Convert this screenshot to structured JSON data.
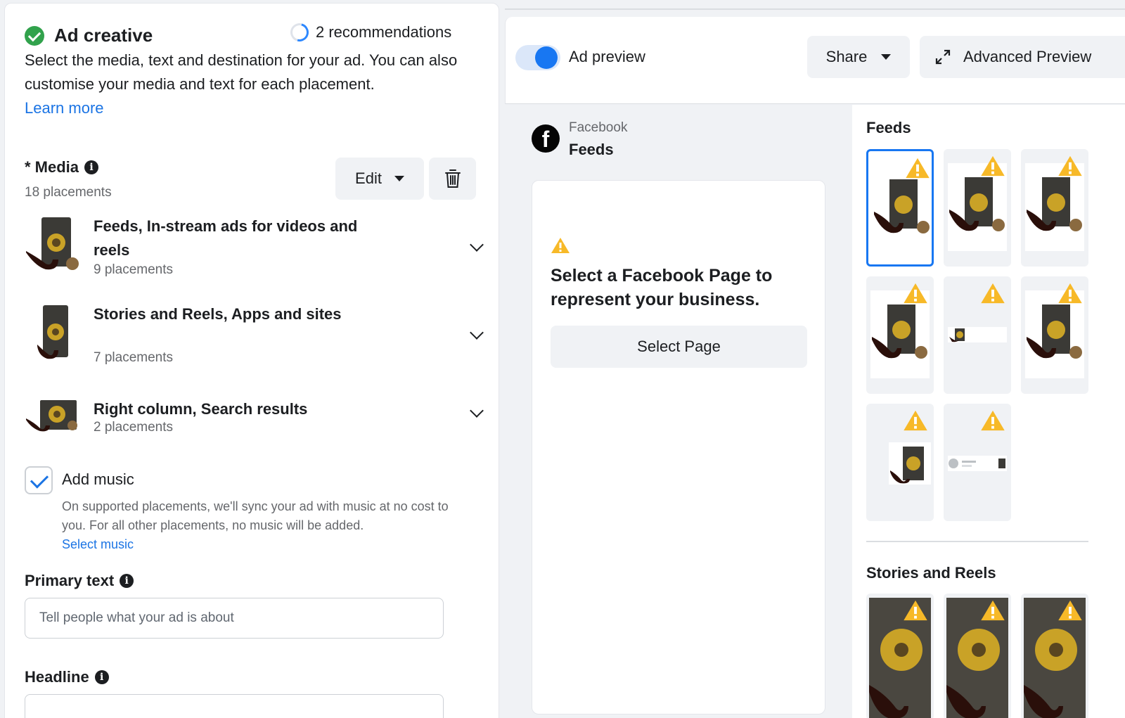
{
  "ad_creative": {
    "title": "Ad creative",
    "recommendations": "2 recommendations",
    "description": "Select the media, text and destination for your ad. You can also customise your media and text for each placement.",
    "learn_more": "Learn more"
  },
  "media": {
    "label": "* Media",
    "placements_count": "18 placements",
    "edit_label": "Edit",
    "groups": [
      {
        "title": "Feeds, In-stream ads for videos and reels",
        "sub": "9 placements"
      },
      {
        "title": "Stories and Reels, Apps and sites",
        "sub": "7 placements"
      },
      {
        "title": "Right column, Search results",
        "sub": "2 placements"
      }
    ]
  },
  "music": {
    "title": "Add music",
    "checked": true,
    "description": "On supported placements, we'll sync your ad with music at no cost to you. For all other placements, no music will be added.",
    "link": "Select music"
  },
  "primary_text": {
    "label": "Primary text",
    "placeholder": "Tell people what your ad is about"
  },
  "headline": {
    "label": "Headline"
  },
  "preview": {
    "toggle_label": "Ad preview",
    "toggle_on": true,
    "share_label": "Share",
    "advanced_label": "Advanced Preview",
    "platform": "Facebook",
    "placement": "Feeds",
    "message": "Select a Facebook Page to represent your business.",
    "select_page": "Select Page"
  },
  "side": {
    "feeds_title": "Feeds",
    "stories_title": "Stories and Reels"
  },
  "colors": {
    "accent": "#1877f2",
    "link": "#1b74e4",
    "success": "#31a24c",
    "warning": "#f7b928"
  }
}
